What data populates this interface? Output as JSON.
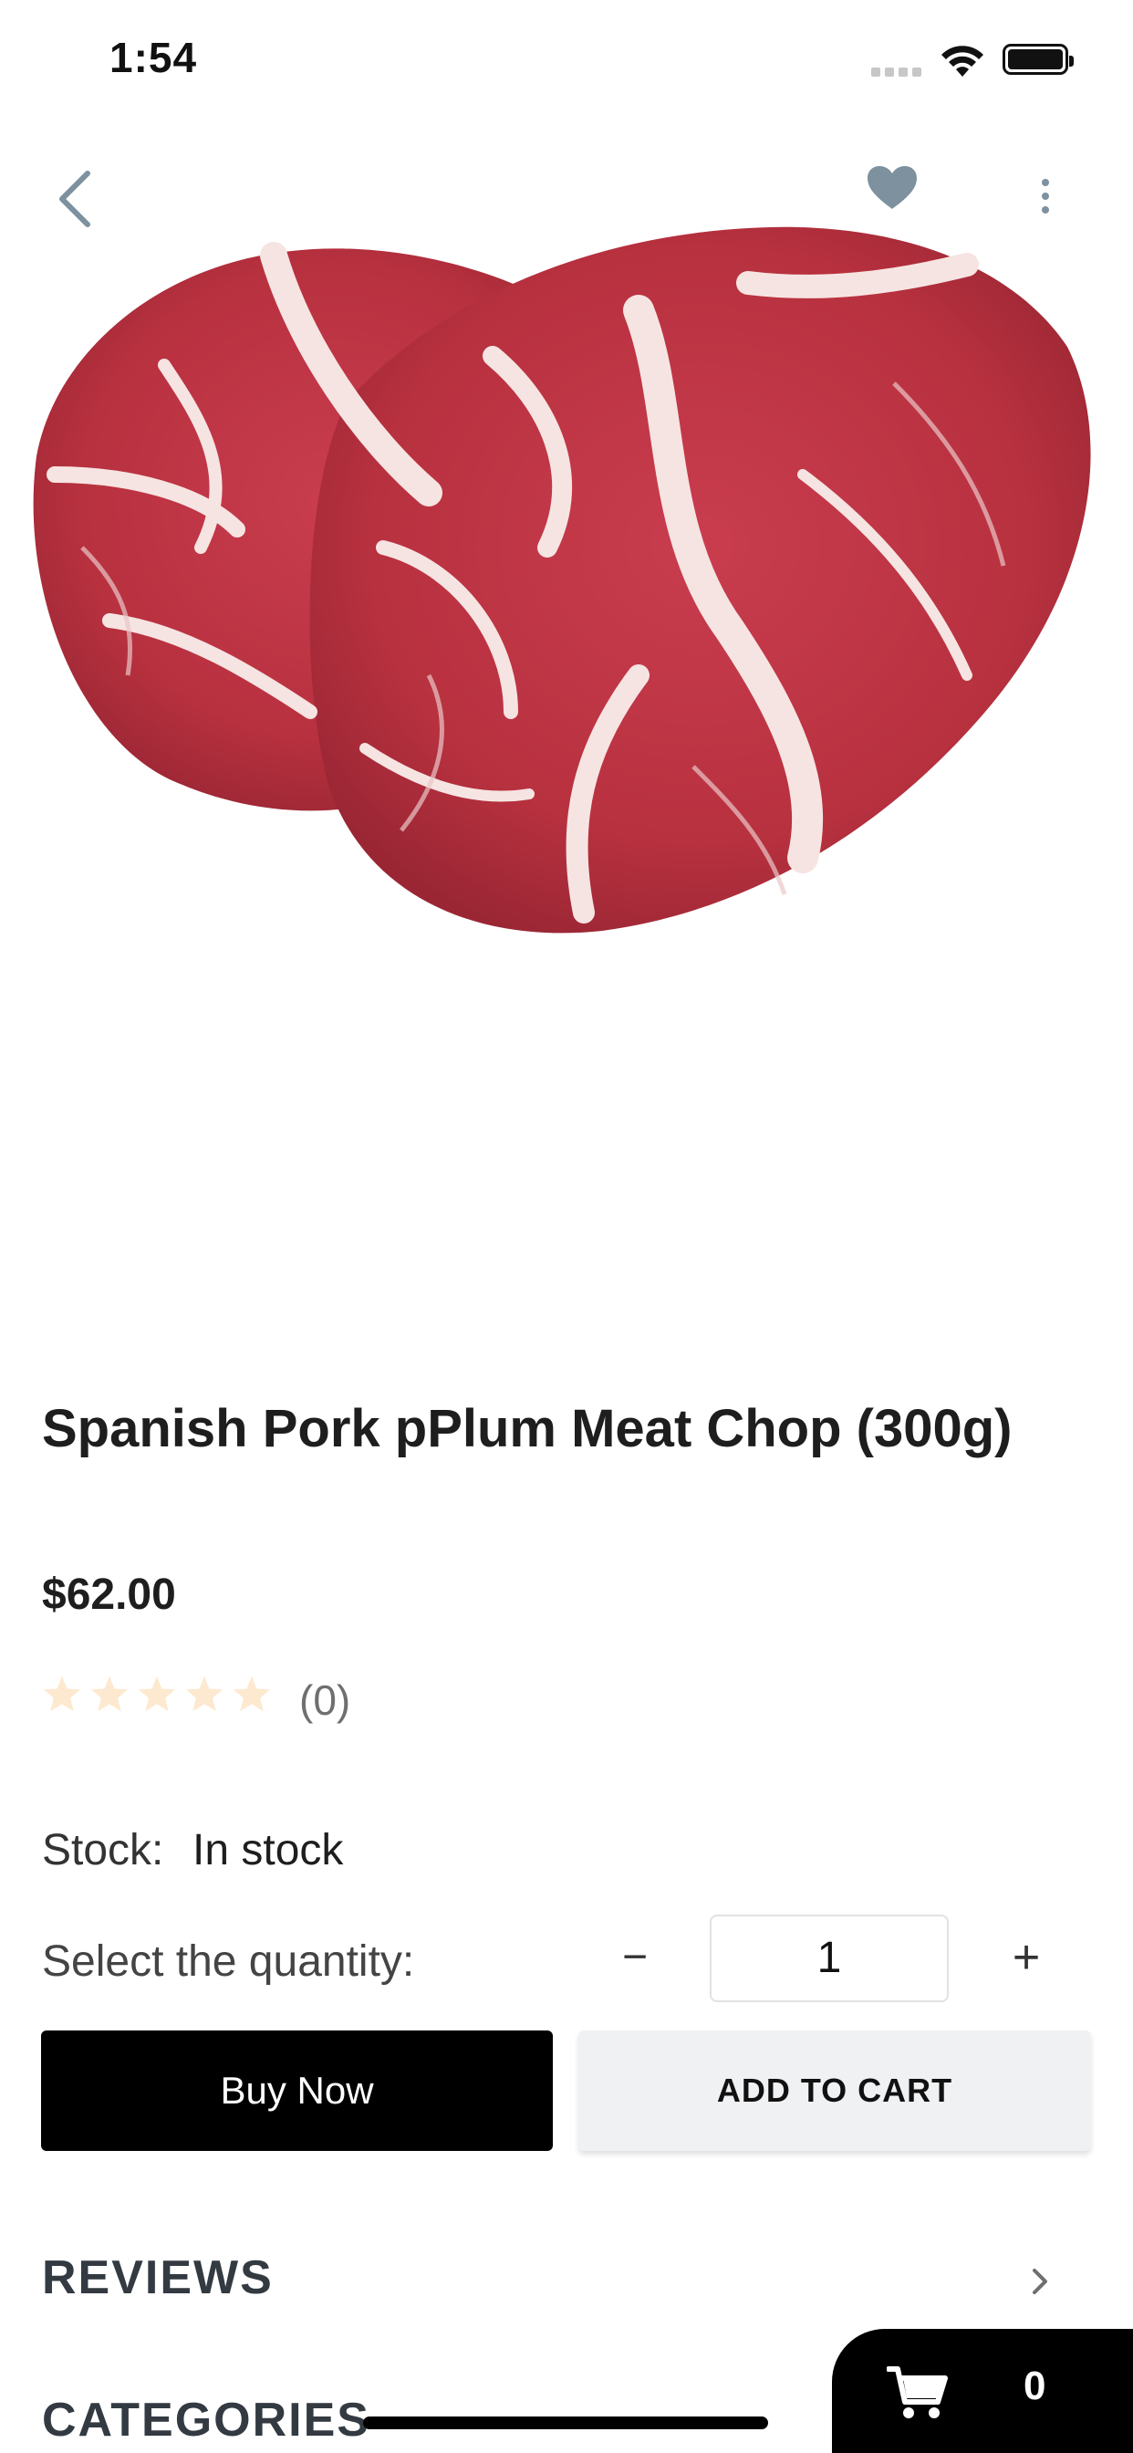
{
  "status_bar": {
    "time": "1:54"
  },
  "nav": {
    "back_icon": "chevron-left-icon",
    "favorite_icon": "heart-icon",
    "more_icon": "more-vertical-icon"
  },
  "product": {
    "title": "Spanish Pork pPlum Meat Chop (300g)",
    "price": "$62.00",
    "rating": {
      "value": 0,
      "max": 5,
      "count_text": "(0)"
    },
    "stock_label": "Stock:",
    "stock_value": "In stock",
    "quantity_label": "Select the quantity:",
    "quantity_minus": "−",
    "quantity_value": "1",
    "quantity_plus": "+"
  },
  "actions": {
    "buy_now": "Buy Now",
    "add_to_cart": "ADD TO CART"
  },
  "sections": {
    "reviews": "REVIEWS",
    "categories": "CATEGORIES"
  },
  "floating_cart": {
    "icon": "cart-icon",
    "count": "0"
  },
  "colors": {
    "accent_icon": "#7d919f",
    "star_empty": "#fde9cf",
    "button_dark": "#000000",
    "button_light": "#f0f1f3"
  }
}
